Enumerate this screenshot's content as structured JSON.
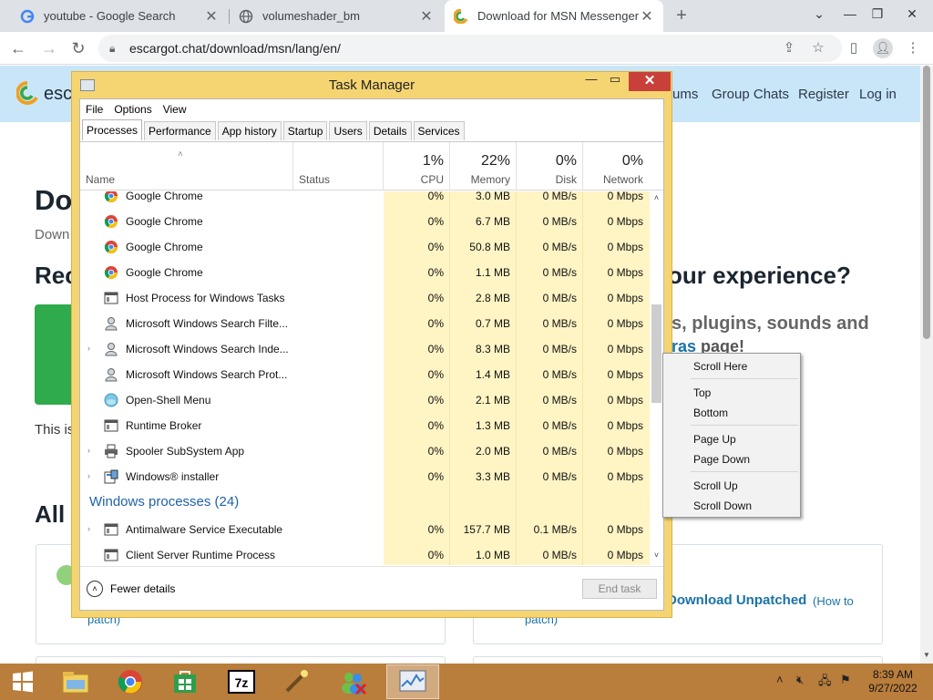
{
  "browser": {
    "tabs": [
      {
        "label": "youtube - Google Search",
        "icon": "google-g-icon"
      },
      {
        "label": "volumeshader_bm",
        "icon": "globe-icon"
      },
      {
        "label": "Download for MSN Messenger | E",
        "icon": "escargot-icon"
      }
    ],
    "new_tab": "+",
    "url": "escargot.chat/download/msn/lang/en/"
  },
  "page": {
    "brand": "esc",
    "nav": [
      "ums",
      "Group Chats",
      "Register",
      "Log in"
    ],
    "h1": "Do",
    "sub": "Down",
    "h2_left": "Rec",
    "h2_right": "our experience?",
    "p1": "s, plugins, sounds and",
    "p2_link": "ras",
    "p2": " page!",
    "p3": "This is",
    "all": "All",
    "card_patch_left": "patch)",
    "card_patch_right": "patch)",
    "dl_unpatched": "Download Unpatched",
    "how_to": "(How to"
  },
  "task_manager": {
    "title": "Task Manager",
    "menu": [
      "File",
      "Options",
      "View"
    ],
    "tabs": [
      "Processes",
      "Performance",
      "App history",
      "Startup",
      "Users",
      "Details",
      "Services"
    ],
    "active_tab": "Processes",
    "columns": {
      "name": "Name",
      "status": "Status",
      "cpu": {
        "pct": "1%",
        "label": "CPU"
      },
      "memory": {
        "pct": "22%",
        "label": "Memory"
      },
      "disk": {
        "pct": "0%",
        "label": "Disk"
      },
      "network": {
        "pct": "0%",
        "label": "Network"
      }
    },
    "rows": [
      {
        "expand": "",
        "icon": "chrome-icon",
        "name": "Google Chrome",
        "cpu": "0%",
        "mem": "3.0 MB",
        "disk": "0 MB/s",
        "net": "0 Mbps"
      },
      {
        "expand": "",
        "icon": "chrome-icon",
        "name": "Google Chrome",
        "cpu": "0%",
        "mem": "6.7 MB",
        "disk": "0 MB/s",
        "net": "0 Mbps"
      },
      {
        "expand": "",
        "icon": "chrome-icon",
        "name": "Google Chrome",
        "cpu": "0%",
        "mem": "50.8 MB",
        "disk": "0 MB/s",
        "net": "0 Mbps"
      },
      {
        "expand": "",
        "icon": "chrome-icon",
        "name": "Google Chrome",
        "cpu": "0%",
        "mem": "1.1 MB",
        "disk": "0 MB/s",
        "net": "0 Mbps"
      },
      {
        "expand": "",
        "icon": "window-icon",
        "name": "Host Process for Windows Tasks",
        "cpu": "0%",
        "mem": "2.8 MB",
        "disk": "0 MB/s",
        "net": "0 Mbps"
      },
      {
        "expand": "",
        "icon": "user-search-icon",
        "name": "Microsoft Windows Search Filte...",
        "cpu": "0%",
        "mem": "0.7 MB",
        "disk": "0 MB/s",
        "net": "0 Mbps"
      },
      {
        "expand": "›",
        "icon": "user-search-icon",
        "name": "Microsoft Windows Search Inde...",
        "cpu": "0%",
        "mem": "8.3 MB",
        "disk": "0 MB/s",
        "net": "0 Mbps"
      },
      {
        "expand": "",
        "icon": "user-search-icon",
        "name": "Microsoft Windows Search Prot...",
        "cpu": "0%",
        "mem": "1.4 MB",
        "disk": "0 MB/s",
        "net": "0 Mbps"
      },
      {
        "expand": "",
        "icon": "shell-icon",
        "name": "Open-Shell Menu",
        "cpu": "0%",
        "mem": "2.1 MB",
        "disk": "0 MB/s",
        "net": "0 Mbps"
      },
      {
        "expand": "",
        "icon": "window-icon",
        "name": "Runtime Broker",
        "cpu": "0%",
        "mem": "1.3 MB",
        "disk": "0 MB/s",
        "net": "0 Mbps"
      },
      {
        "expand": "›",
        "icon": "printer-icon",
        "name": "Spooler SubSystem App",
        "cpu": "0%",
        "mem": "2.0 MB",
        "disk": "0 MB/s",
        "net": "0 Mbps"
      },
      {
        "expand": "›",
        "icon": "installer-icon",
        "name": "Windows® installer",
        "cpu": "0%",
        "mem": "3.3 MB",
        "disk": "0 MB/s",
        "net": "0 Mbps"
      }
    ],
    "group_label": "Windows processes (24)",
    "rows2": [
      {
        "expand": "›",
        "icon": "window-icon",
        "name": "Antimalware Service Executable",
        "cpu": "0%",
        "mem": "157.7 MB",
        "disk": "0.1 MB/s",
        "net": "0 Mbps"
      },
      {
        "expand": "",
        "icon": "window-icon",
        "name": "Client Server Runtime Process",
        "cpu": "0%",
        "mem": "1.0 MB",
        "disk": "0 MB/s",
        "net": "0 Mbps"
      }
    ],
    "fewer_details": "Fewer details",
    "end_task": "End task"
  },
  "context_menu": {
    "items": [
      "Scroll Here",
      "Top",
      "Bottom",
      "Page Up",
      "Page Down",
      "Scroll Up",
      "Scroll Down"
    ]
  },
  "taskbar": {
    "items": [
      "start-button",
      "file-explorer",
      "chrome",
      "store",
      "7zip",
      "wand",
      "msn",
      "task-manager"
    ],
    "time": "8:39 AM",
    "date": "9/27/2022"
  },
  "colors": {
    "tm_frame": "#f5d572",
    "tm_cell_highlight": "#fff4c4",
    "close_red": "#c9403a",
    "taskbar": "#b97d3c",
    "group_blue": "#1f62a8",
    "site_header": "#c9e6f8"
  }
}
